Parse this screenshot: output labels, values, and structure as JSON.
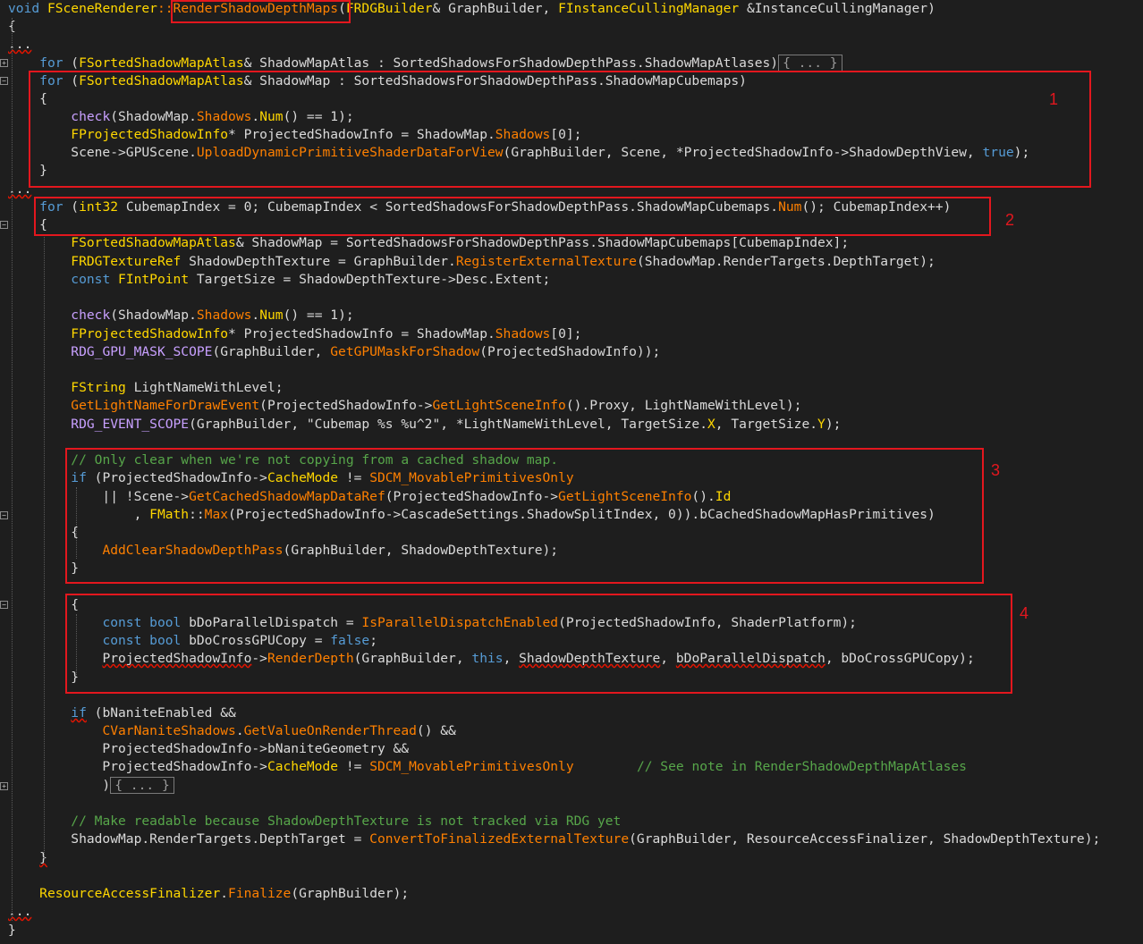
{
  "editor": {
    "lines": [
      {
        "key": "l0",
        "html": "<span class='t-kw'>void</span> <span class='t-cls'>FSceneRenderer</span><span class='t-fn'>::RenderShadowDepthMaps</span>(<span class='t-cls'>FRDGBuilder</span>&amp; GraphBuilder, <span class='t-cls'>FInstanceCullingManager</span> &amp;InstanceCullingManager)"
      },
      {
        "key": "l1",
        "html": "{"
      },
      {
        "key": "l2",
        "html": "<span class='t-sq'>...</span>"
      },
      {
        "key": "l3",
        "html": "    <span class='t-kw'>for</span> (<span class='t-cls'>FSortedShadowMapAtlas</span>&amp; ShadowMapAtlas : SortedShadowsForShadowDepthPass.ShadowMapAtlases)<span class='collapsed'>{ ... }</span>"
      },
      {
        "key": "l4",
        "html": "    <span class='t-kw'>for</span> (<span class='t-cls'>FSortedShadowMapAtlas</span>&amp; ShadowMap : SortedShadowsForShadowDepthPass.ShadowMapCubemaps)"
      },
      {
        "key": "l5",
        "html": "    {"
      },
      {
        "key": "l6",
        "html": "        <span class='t-mac'>check</span>(ShadowMap.<span class='t-macv'>Shadows</span>.<span class='t-prop'>Num</span>() == 1);"
      },
      {
        "key": "l7",
        "html": "        <span class='t-cls'>FProjectedShadowInfo</span>* ProjectedShadowInfo = ShadowMap.<span class='t-macv'>Shadows</span>[0];"
      },
      {
        "key": "l8",
        "html": "        Scene-&gt;GPUScene.<span class='t-fn'>UploadDynamicPrimitiveShaderDataForView</span>(GraphBuilder, Scene, *ProjectedShadowInfo-&gt;ShadowDepthView, <span class='t-kw'>true</span>);"
      },
      {
        "key": "l9",
        "html": "    }"
      },
      {
        "key": "l10",
        "html": "<span class='t-sq'>...</span>"
      },
      {
        "key": "l11",
        "html": "    <span class='t-kw'>for</span> (<span class='t-cls'>int32</span> CubemapIndex = 0; CubemapIndex &lt; SortedShadowsForShadowDepthPass.ShadowMapCubemaps.<span class='t-fn'>Num</span>(); CubemapIndex++)"
      },
      {
        "key": "l12",
        "html": "    {"
      },
      {
        "key": "l13",
        "html": "        <span class='t-cls'>FSortedShadowMapAtlas</span>&amp; ShadowMap = SortedShadowsForShadowDepthPass.ShadowMapCubemaps[CubemapIndex];"
      },
      {
        "key": "l14",
        "html": "        <span class='t-cls'>FRDGTextureRef</span> ShadowDepthTexture = GraphBuilder.<span class='t-fn'>RegisterExternalTexture</span>(ShadowMap.RenderTargets.DepthTarget);"
      },
      {
        "key": "l15",
        "html": "        <span class='t-kw'>const</span> <span class='t-cls'>FIntPoint</span> TargetSize = ShadowDepthTexture-&gt;Desc.Extent;"
      },
      {
        "key": "l16",
        "html": ""
      },
      {
        "key": "l17",
        "html": "        <span class='t-mac'>check</span>(ShadowMap.<span class='t-macv'>Shadows</span>.<span class='t-prop'>Num</span>() == 1);"
      },
      {
        "key": "l18",
        "html": "        <span class='t-cls'>FProjectedShadowInfo</span>* ProjectedShadowInfo = ShadowMap.<span class='t-macv'>Shadows</span>[0];"
      },
      {
        "key": "l19",
        "html": "        <span class='t-mac'>RDG_GPU_MASK_SCOPE</span>(GraphBuilder, <span class='t-fn'>GetGPUMaskForShadow</span>(ProjectedShadowInfo));"
      },
      {
        "key": "l20",
        "html": ""
      },
      {
        "key": "l21",
        "html": "        <span class='t-cls'>FString</span> LightNameWithLevel;"
      },
      {
        "key": "l22",
        "html": "        <span class='t-fn'>GetLightNameForDrawEvent</span>(ProjectedShadowInfo-&gt;<span class='t-fn'>GetLightSceneInfo</span>().Proxy, LightNameWithLevel);"
      },
      {
        "key": "l23",
        "html": "        <span class='t-mac'>RDG_EVENT_SCOPE</span>(GraphBuilder, <span class='t-fld'>\"Cubemap %s %u^2\"</span>, *LightNameWithLevel, TargetSize.<span class='t-prop'>X</span>, TargetSize.<span class='t-prop'>Y</span>);"
      },
      {
        "key": "l24",
        "html": ""
      },
      {
        "key": "l25",
        "html": "        <span class='t-cmt'>// Only clear when we're not copying from a cached shadow map.</span>"
      },
      {
        "key": "l26",
        "html": "        <span class='t-kw'>if</span> (ProjectedShadowInfo-&gt;<span class='t-prop'>CacheMode</span> != <span class='t-macv'>SDCM_MovablePrimitivesOnly</span>"
      },
      {
        "key": "l27",
        "html": "            || !Scene-&gt;<span class='t-fn'>GetCachedShadowMapDataRef</span>(ProjectedShadowInfo-&gt;<span class='t-fn'>GetLightSceneInfo</span>().<span class='t-prop'>Id</span>"
      },
      {
        "key": "l28",
        "html": "                , <span class='t-cls'>FMath</span>::<span class='t-fn'>Max</span>(ProjectedShadowInfo-&gt;CascadeSettings.ShadowSplitIndex, 0)).bCachedShadowMapHasPrimitives)"
      },
      {
        "key": "l29",
        "html": "        {"
      },
      {
        "key": "l30",
        "html": "            <span class='t-fn'>AddClearShadowDepthPass</span>(GraphBuilder, ShadowDepthTexture);"
      },
      {
        "key": "l31",
        "html": "        }"
      },
      {
        "key": "l32",
        "html": ""
      },
      {
        "key": "l33",
        "html": "        {"
      },
      {
        "key": "l34",
        "html": "            <span class='t-kw'>const</span> <span class='t-kw'>bool</span> bDoParallelDispatch = <span class='t-fn'>IsParallelDispatchEnabled</span>(ProjectedShadowInfo, ShaderPlatform);"
      },
      {
        "key": "l35",
        "html": "            <span class='t-kw'>const</span> <span class='t-kw'>bool</span> bDoCrossGPUCopy = <span class='t-kw'>false</span>;"
      },
      {
        "key": "l36",
        "html": "            <span class='t-sq'>ProjectedShadowInfo</span>-&gt;<span class='t-fn'>RenderDepth</span>(GraphBuilder, <span class='t-kw'>this</span>, <span class='t-sq'>ShadowDepthTexture</span>, <span class='t-sq'>bDoParallelDispatch</span>, bDoCrossGPUCopy);"
      },
      {
        "key": "l37",
        "html": "        }"
      },
      {
        "key": "l38",
        "html": ""
      },
      {
        "key": "l39",
        "html": "        <span class='t-kw t-sq'>if</span> (bNaniteEnabled &amp;&amp;"
      },
      {
        "key": "l40",
        "html": "            <span class='t-fn'>CVarNaniteShadows</span>.<span class='t-fn'>GetValueOnRenderThread</span>() &amp;&amp;"
      },
      {
        "key": "l41",
        "html": "            ProjectedShadowInfo-&gt;bNaniteGeometry &amp;&amp;"
      },
      {
        "key": "l42",
        "html": "            ProjectedShadowInfo-&gt;<span class='t-prop'>CacheMode</span> != <span class='t-macv'>SDCM_MovablePrimitivesOnly</span>        <span class='t-cmt'>// See note in RenderShadowDepthMapAtlases</span>"
      },
      {
        "key": "l43",
        "html": "            )<span class='collapsed'>{ ... }</span>"
      },
      {
        "key": "l44",
        "html": ""
      },
      {
        "key": "l45",
        "html": "        <span class='t-cmt'>// Make readable because ShadowDepthTexture is not tracked via RDG yet</span>"
      },
      {
        "key": "l46",
        "html": "        ShadowMap.RenderTargets.DepthTarget = <span class='t-fn'>ConvertToFinalizedExternalTexture</span>(GraphBuilder, ResourceAccessFinalizer, ShadowDepthTexture);"
      },
      {
        "key": "l47",
        "html": "    <span class='t-sq'>}</span>"
      },
      {
        "key": "l48",
        "html": ""
      },
      {
        "key": "l49",
        "html": "    <span class='t-cls'>ResourceAccessFinalizer</span>.<span class='t-fn'>Finalize</span>(GraphBuilder);"
      },
      {
        "key": "l50",
        "html": "<span class='t-sq'>...</span>"
      },
      {
        "key": "l51",
        "html": "}"
      }
    ]
  },
  "annotations": [
    {
      "label": "1"
    },
    {
      "label": "2"
    },
    {
      "label": "3"
    },
    {
      "label": "4"
    }
  ]
}
